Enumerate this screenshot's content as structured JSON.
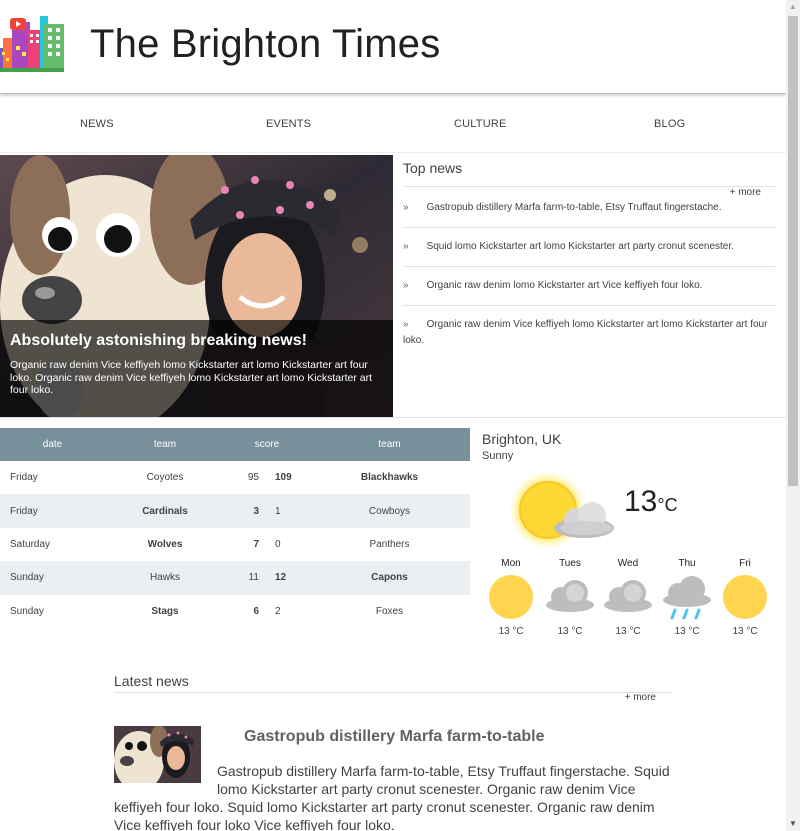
{
  "site": {
    "title": "The Brighton Times"
  },
  "nav": {
    "items": [
      {
        "label": "NEWS"
      },
      {
        "label": "EVENTS"
      },
      {
        "label": "CULTURE"
      },
      {
        "label": "BLOG"
      }
    ]
  },
  "hero": {
    "title": "Absolutely astonishing breaking news!",
    "text": "Organic raw denim Vice keffiyeh lomo Kickstarter art lomo Kickstarter art four loko. Organic raw denim Vice keffiyeh lomo Kickstarter art lomo Kickstarter art four loko."
  },
  "top_news": {
    "title": "Top news",
    "more": "+ more",
    "bullet": "»",
    "items": [
      {
        "text": "Gastropub distillery Marfa farm-to-table, Etsy Truffaut fingerstache."
      },
      {
        "text": "Squid lomo Kickstarter art lomo Kickstarter art party cronut scenester."
      },
      {
        "text": "Organic raw denim lomo Kickstarter art Vice keffiyeh four loko."
      },
      {
        "text": "Organic raw denim Vice keffiyeh lomo Kickstarter art lomo Kickstarter art four loko."
      }
    ]
  },
  "scores": {
    "headers": {
      "date": "date",
      "team1": "team",
      "score": "score",
      "team2": "team"
    },
    "rows": [
      {
        "date": "Friday",
        "team1": "Coyotes",
        "score1": "95",
        "score2": "109",
        "team2": "Blackhawks",
        "winner": 2
      },
      {
        "date": "Friday",
        "team1": "Cardinals",
        "score1": "3",
        "score2": "1",
        "team2": "Cowboys",
        "winner": 1
      },
      {
        "date": "Saturday",
        "team1": "Wolves",
        "score1": "7",
        "score2": "0",
        "team2": "Panthers",
        "winner": 1
      },
      {
        "date": "Sunday",
        "team1": "Hawks",
        "score1": "11",
        "score2": "12",
        "team2": "Capons",
        "winner": 2
      },
      {
        "date": "Sunday",
        "team1": "Stags",
        "score1": "6",
        "score2": "2",
        "team2": "Foxes",
        "winner": 1
      }
    ]
  },
  "weather": {
    "city": "Brighton, UK",
    "condition": "Sunny",
    "temp": "13",
    "unit": "°C",
    "main_icon": "sun-behind-cloud-icon",
    "forecast": [
      {
        "day": "Mon",
        "icon": "sun-icon",
        "temp": "13 °C"
      },
      {
        "day": "Tues",
        "icon": "cloud-icon",
        "temp": "13 °C"
      },
      {
        "day": "Wed",
        "icon": "cloud-icon",
        "temp": "13 °C"
      },
      {
        "day": "Thu",
        "icon": "rain-icon",
        "temp": "13 °C"
      },
      {
        "day": "Fri",
        "icon": "sun-icon",
        "temp": "13 °C"
      }
    ]
  },
  "latest_news": {
    "title": "Latest news",
    "more": "+ more",
    "article": {
      "title": "Gastropub distillery Marfa farm-to-table",
      "body": "Gastropub distillery Marfa farm-to-table, Etsy Truffaut fingerstache. Squid lomo Kickstarter art party cronut scenester. Organic raw denim Vice keffiyeh four loko. Squid lomo Kickstarter art party cronut scenester. Organic raw denim Vice keffiyeh four loko Vice keffiyeh four loko."
    }
  },
  "colors": {
    "table_header": "#78909c",
    "table_alt_row": "#eceff1",
    "sun": "#ffd54f",
    "cloud": "#bdbdbd",
    "rain": "#4fc3f7"
  }
}
